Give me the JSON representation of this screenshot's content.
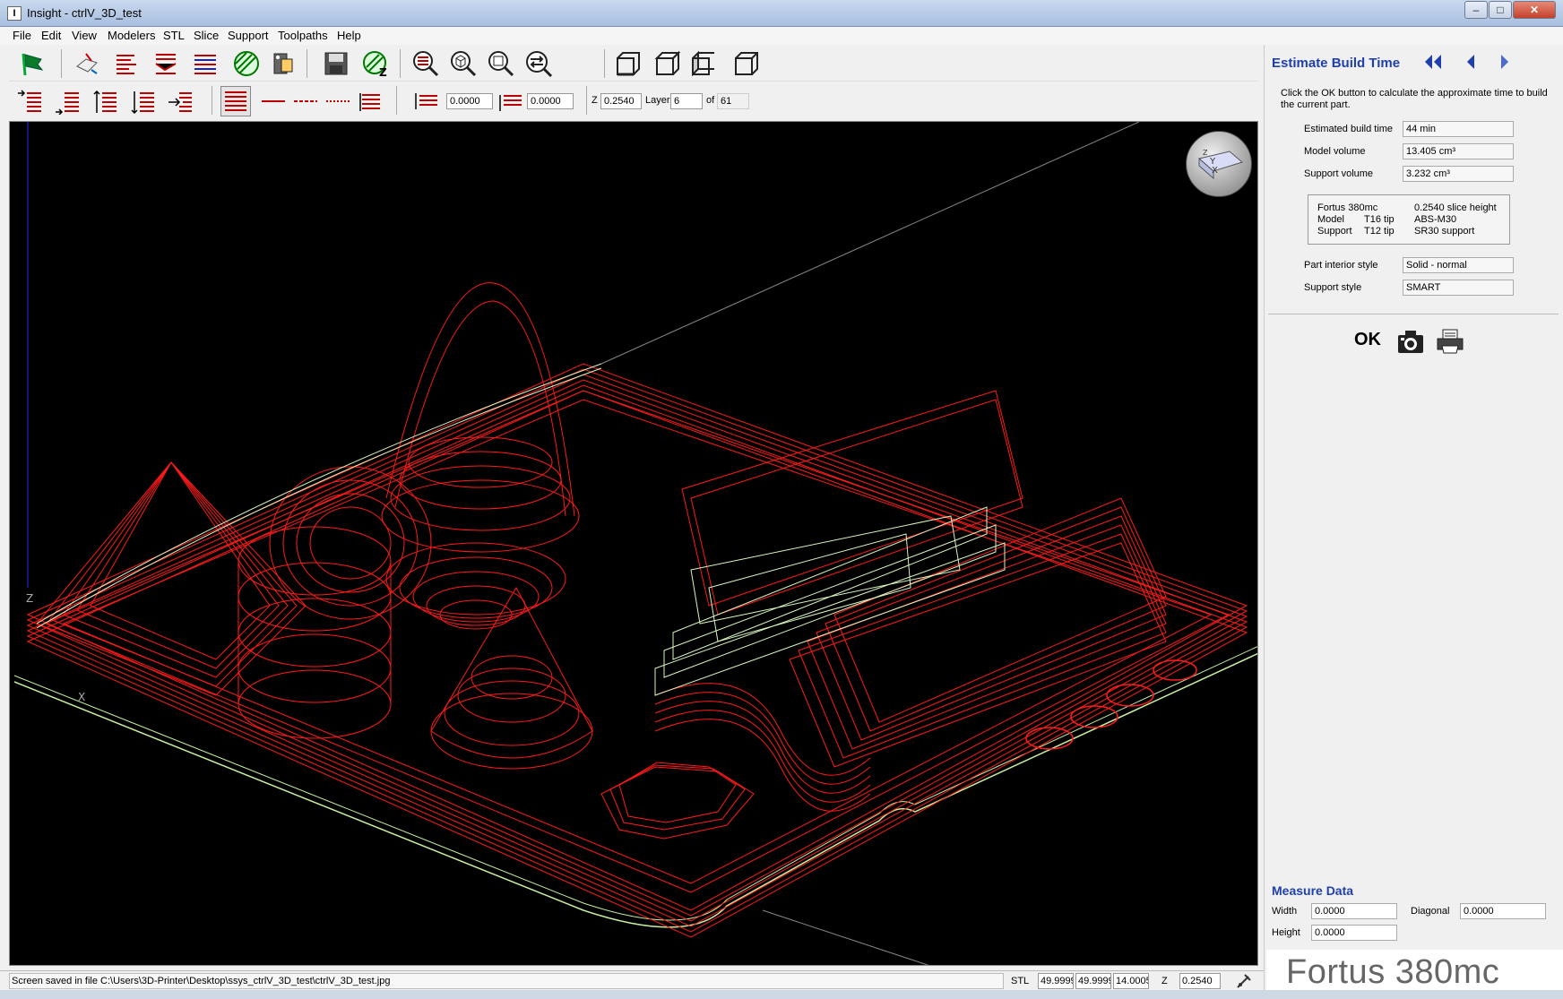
{
  "window": {
    "title": "Insight - ctrlV_3D_test",
    "app_icon_letter": "I",
    "minimize_glyph": "–",
    "maximize_glyph": "□",
    "close_glyph": "✕"
  },
  "menu": [
    {
      "label": "File"
    },
    {
      "label": "Edit"
    },
    {
      "label": "View"
    },
    {
      "label": "Modelers"
    },
    {
      "label": "STL"
    },
    {
      "label": "Slice"
    },
    {
      "label": "Support"
    },
    {
      "label": "Toolpaths"
    },
    {
      "label": "Help"
    }
  ],
  "toolbar2": {
    "offset1": "0.0000",
    "offset2": "0.0000",
    "z_label": "Z",
    "z_value": "0.2540",
    "layer_label": "Layer",
    "layer_value": "6",
    "of_label": "of",
    "of_value": "61"
  },
  "viewport": {
    "z_axis_label": "Z",
    "x_axis_label": "X",
    "nav_cube_y": "Y",
    "nav_cube_x": "X",
    "nav_cube_z": "Z"
  },
  "panel": {
    "title": "Estimate Build Time",
    "instruction": "Click the OK button to calculate the approximate time to build the current part.",
    "fields": [
      {
        "label": "Estimated build time",
        "value": "44 min"
      },
      {
        "label": "Model volume",
        "value": "13.405 cm³"
      },
      {
        "label": "Support volume",
        "value": "3.232 cm³"
      }
    ],
    "machine": {
      "name": "Fortus 380mc",
      "slice_height": "0.2540 slice height",
      "model_label": "Model",
      "model_tip": "T16 tip",
      "model_material": "ABS-M30",
      "support_label": "Support",
      "support_tip": "T12 tip",
      "support_material": "SR30 support"
    },
    "style_fields": [
      {
        "label": "Part interior style",
        "value": "Solid - normal"
      },
      {
        "label": "Support style",
        "value": "SMART"
      }
    ],
    "ok_label": "OK",
    "measure": {
      "title": "Measure Data",
      "width_label": "Width",
      "width_value": "0.0000",
      "height_label": "Height",
      "height_value": "0.0000",
      "diagonal_label": "Diagonal",
      "diagonal_value": "0.0000"
    },
    "brand": "Fortus 380mc"
  },
  "status": {
    "message": "Screen saved in file C:\\Users\\3D-Printer\\Desktop\\ssys_ctrlV_3D_test\\ctrlV_3D_test.jpg",
    "stl_label": "STL",
    "stl_x": "49.9999",
    "stl_y": "49.9999",
    "stl_z": "14.0005",
    "z_label": "Z",
    "z_value": "0.2540"
  },
  "colors": {
    "toolpath_red": "#ff1a1a",
    "support_green": "#c8f0a0",
    "panel_heading_blue": "#1f3fb0",
    "viewport_bg": "#000000"
  }
}
